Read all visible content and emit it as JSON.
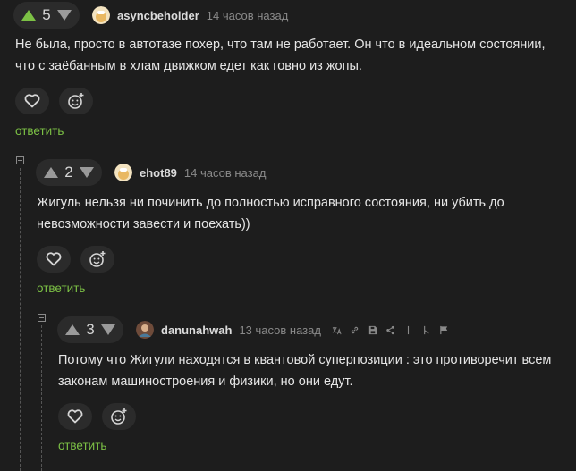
{
  "comments": [
    {
      "votes": "5",
      "username": "asyncbeholder",
      "time": "14 часов назад",
      "text": "Не была, просто в автотазе похер, что там не работает. Он что в идеальном состоянии, что с заёбанным в хлам движком едет как говно из жопы.",
      "reply_label": "ответить"
    },
    {
      "votes": "2",
      "username": "ehot89",
      "time": "14 часов назад",
      "text": "Жигуль нельзя ни починить до полностью исправного состояния, ни убить до невозможности завести и поехать))",
      "reply_label": "ответить"
    },
    {
      "votes": "3",
      "username": "danunahwah",
      "time": "13 часов назад",
      "text": "Потому что Жигули находятся в квантовой суперпозиции : это противоречит всем законам машиностроения и физики, но они едут.",
      "reply_label": "ответить"
    }
  ],
  "colors": {
    "accent": "#7cc145",
    "bg": "#1d1d1d",
    "pill": "#2b2b2b"
  },
  "icons": [
    "heart-icon",
    "add-reaction-icon",
    "collapse-icon",
    "translate-icon",
    "link-icon",
    "save-icon",
    "share-icon",
    "flag-icon"
  ]
}
